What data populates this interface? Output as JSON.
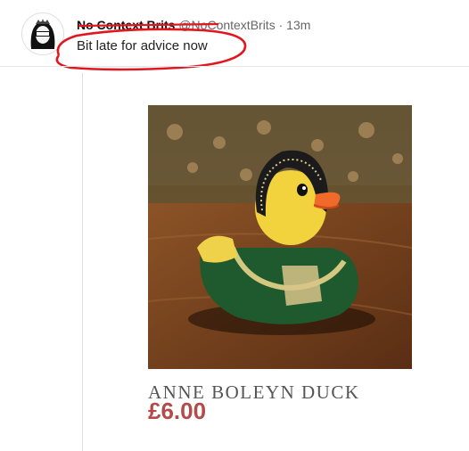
{
  "tweet": {
    "display_name": "No Context Brits",
    "handle": "@NoContextBrits",
    "separator": "·",
    "time": "13m",
    "text": "Bit late for advice now"
  },
  "product": {
    "title": "ANNE BOLEYN DUCK",
    "price": "£6.00"
  },
  "colors": {
    "scribble_red": "#e0171f",
    "price_color": "#b54a4a"
  },
  "icons": {
    "avatar": "queen-portrait-icon"
  }
}
